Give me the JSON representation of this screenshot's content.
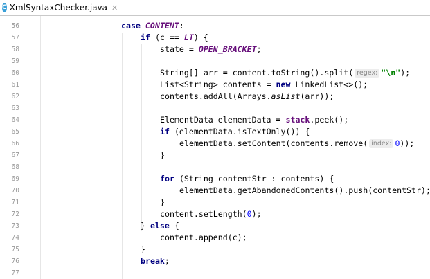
{
  "tab": {
    "filename": "XmlSyntaxChecker.java",
    "icon_letter": "C",
    "close_glyph": "✕"
  },
  "line_numbers": [
    "56",
    "57",
    "58",
    "59",
    "60",
    "61",
    "62",
    "63",
    "64",
    "65",
    "66",
    "67",
    "68",
    "69",
    "70",
    "71",
    "72",
    "73",
    "74",
    "75",
    "76",
    "77"
  ],
  "code": {
    "l56_kw": "case ",
    "l56_const": "CONTENT",
    "l56_rest": ":",
    "l57_kw": "if",
    "l57_a": " (c == ",
    "l57_const": "LT",
    "l57_b": ") {",
    "l58_a": "state = ",
    "l58_const": "OPEN_BRACKET",
    "l58_b": ";",
    "l60_a": "String[] arr = content.toString().split(",
    "l60_hint": "regex:",
    "l60_str": "\"\\n\"",
    "l60_b": ");",
    "l61_a": "List<String> contents = ",
    "l61_kw": "new",
    "l61_b": " LinkedList<>();",
    "l62_a": "contents.addAll(Arrays.",
    "l62_it": "asList",
    "l62_b": "(arr));",
    "l64_a": "ElementData elementData = ",
    "l64_fld": "stack",
    "l64_b": ".peek();",
    "l65_kw": "if",
    "l65_a": " (elementData.isTextOnly()) {",
    "l66_a": "elementData.setContent(contents.remove(",
    "l66_hint": "index:",
    "l66_num": "0",
    "l66_b": "));",
    "l67": "}",
    "l69_kw": "for",
    "l69_a": " (String contentStr : contents) {",
    "l70": "elementData.getAbandonedContents().push(contentStr);",
    "l71": "}",
    "l72_a": "content.setLength(",
    "l72_num": "0",
    "l72_b": ");",
    "l73_a": "} ",
    "l73_kw": "else",
    "l73_b": " {",
    "l74": "content.append(c);",
    "l75": "}",
    "l76_kw": "break",
    "l76_b": ";"
  },
  "colors": {
    "keyword": "#000080",
    "constant": "#660e7a",
    "string": "#008000",
    "number": "#0000ff",
    "line_number": "#999999",
    "hint_bg": "#ededed"
  }
}
